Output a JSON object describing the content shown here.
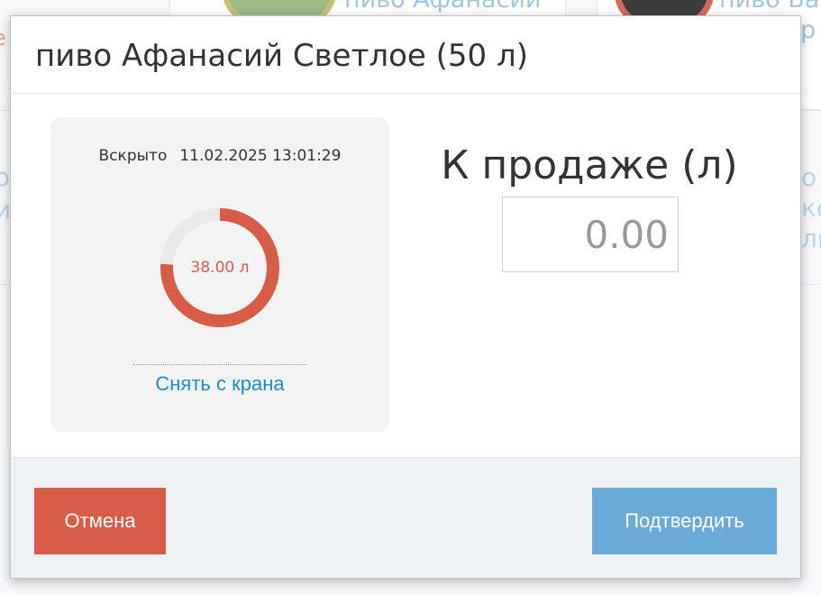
{
  "background": {
    "card1_title": "пиво Афанасий",
    "card2_title": "пиво Ва",
    "card2_subtitle_char": "р",
    "left_fragment_1": "о",
    "left_fragment_2": "и",
    "right_fragment_1": "о",
    "right_fragment_2": "ко",
    "right_fragment_3": "ли",
    "left_red_fragment": "е"
  },
  "modal": {
    "title": "пиво Афанасий Светлое (50 л)",
    "keg": {
      "opened_label": "Вскрыто",
      "opened_datetime": "11.02.2025 13:01:29",
      "remaining_label": "38.00 л",
      "remaining_liters": 38.0,
      "capacity_liters": 50,
      "remove_link": "Снять с крана"
    },
    "sale": {
      "label": "К продаже (л)",
      "value": "",
      "placeholder": "0.00"
    },
    "buttons": {
      "cancel": "Отмена",
      "confirm": "Подтвердить"
    }
  },
  "colors": {
    "accent_red": "#d85d48",
    "accent_blue": "#6aaad7",
    "link_blue": "#1a8fce",
    "gauge_track": "#e9e9e9"
  }
}
